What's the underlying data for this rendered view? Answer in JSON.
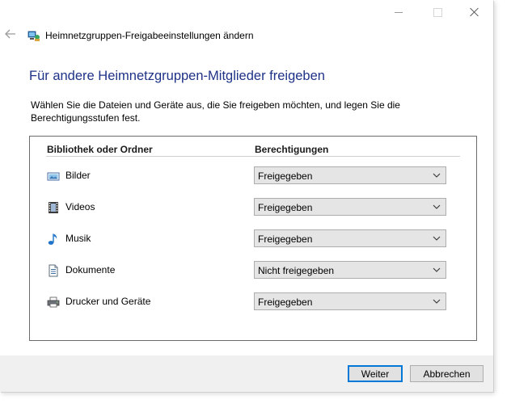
{
  "window": {
    "title": "Heimnetzgruppen-Freigabeeinstellungen ändern"
  },
  "heading": "Für andere Heimnetzgruppen-Mitglieder freigeben",
  "description": "Wählen Sie die Dateien und Geräte aus, die Sie freigeben möchten, und legen Sie die Berechtigungsstufen fest.",
  "table": {
    "col_library": "Bibliothek oder Ordner",
    "col_permissions": "Berechtigungen",
    "rows": [
      {
        "label": "Bilder",
        "icon": "pictures-icon",
        "permission": "Freigegeben"
      },
      {
        "label": "Videos",
        "icon": "videos-icon",
        "permission": "Freigegeben"
      },
      {
        "label": "Musik",
        "icon": "music-icon",
        "permission": "Freigegeben"
      },
      {
        "label": "Dokumente",
        "icon": "documents-icon",
        "permission": "Nicht freigegeben"
      },
      {
        "label": "Drucker und Geräte",
        "icon": "printer-icon",
        "permission": "Freigegeben"
      }
    ]
  },
  "buttons": {
    "next": "Weiter",
    "cancel": "Abbrechen"
  },
  "colors": {
    "heading": "#1e3287",
    "focus_border": "#0078d7"
  }
}
